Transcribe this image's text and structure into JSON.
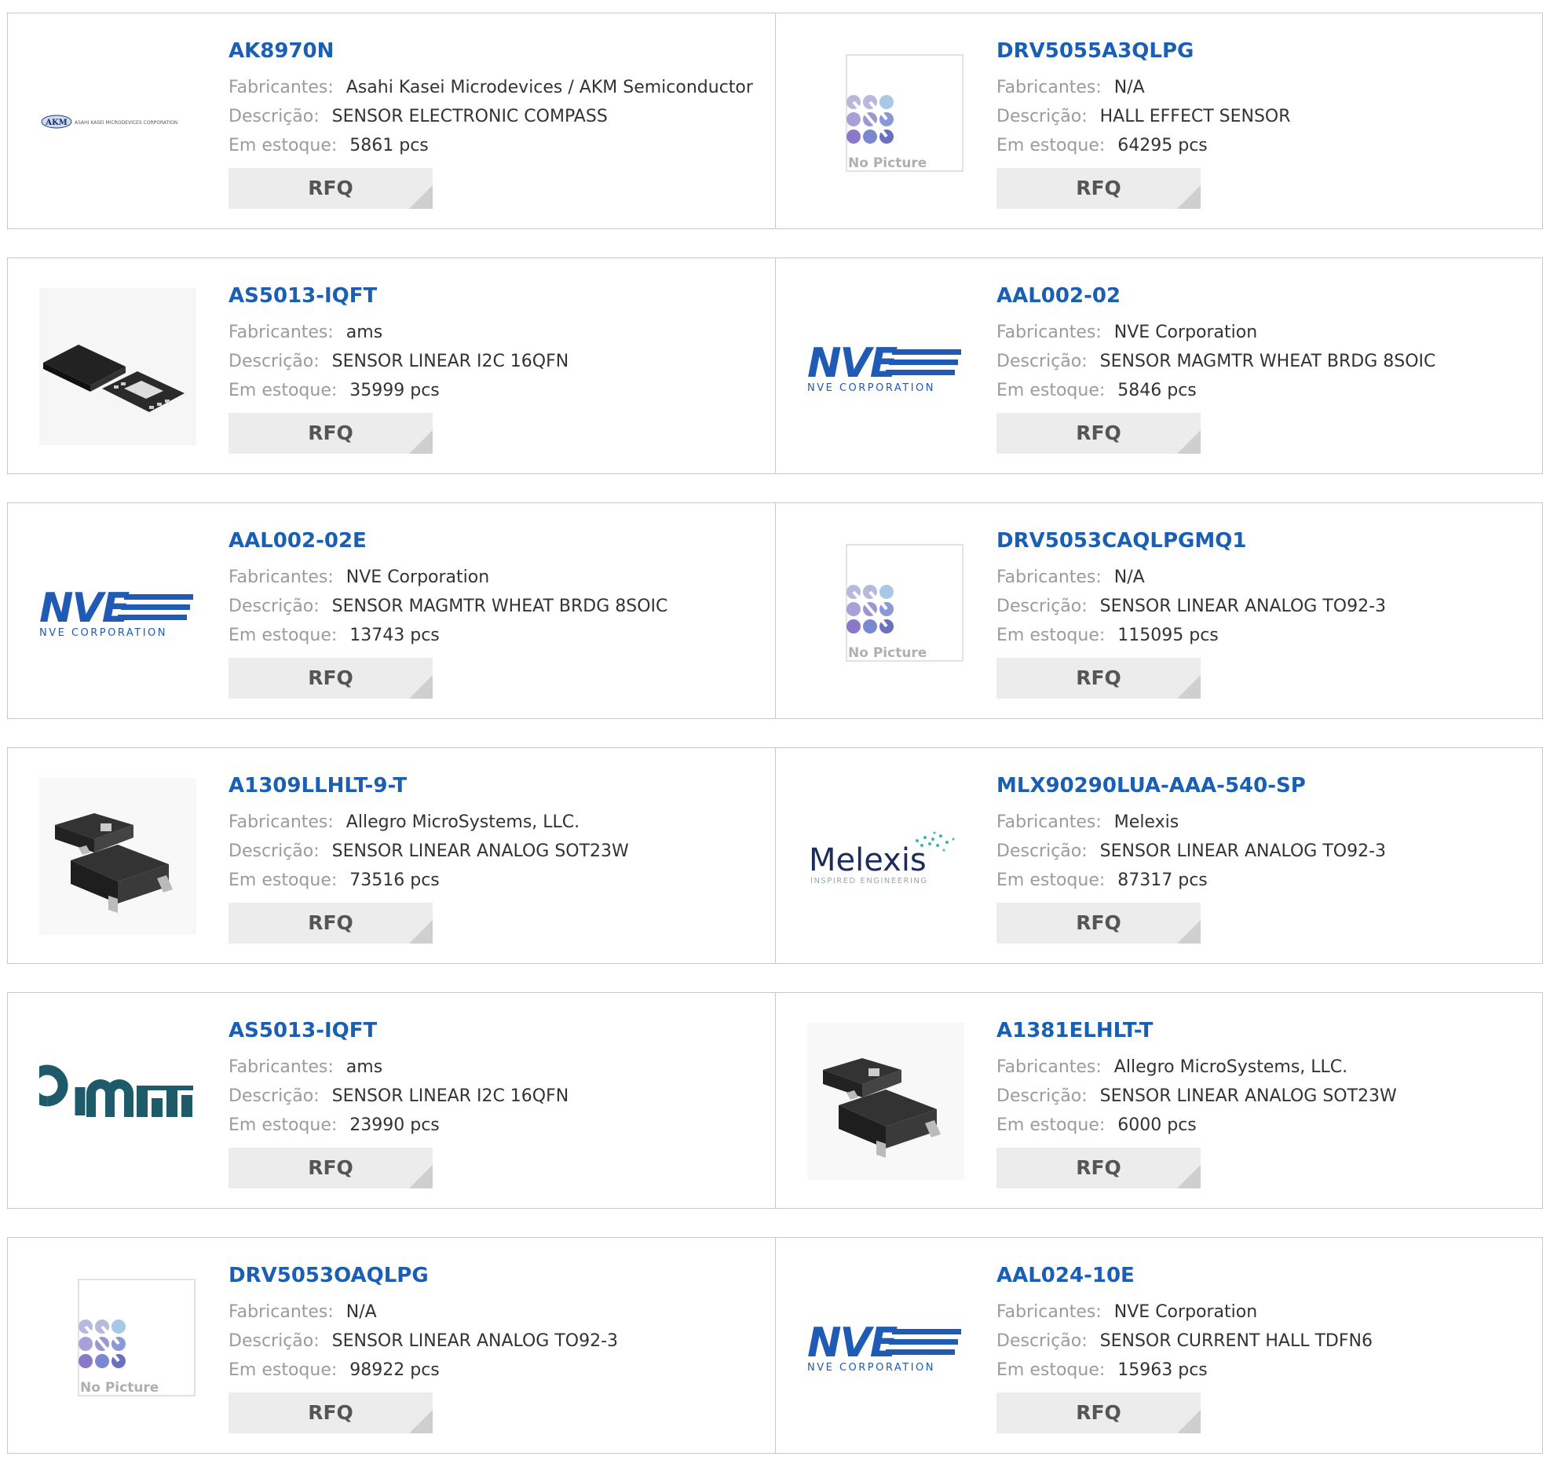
{
  "labels": {
    "manufacturer": "Fabricantes:",
    "description": "Descrição:",
    "stock": "Em estoque:",
    "rfq": "RFQ",
    "no_picture": "No Picture"
  },
  "products": [
    {
      "part": "AK8970N",
      "manufacturer": "Asahi Kasei Microdevices / AKM Semiconductor",
      "description": "SENSOR ELECTRONIC COMPASS",
      "stock": "5861 pcs",
      "image": "akm-logo",
      "logo_text": "AKM",
      "logo_subtext": "ASAHI KASEI MICRODEVICES CORPORATION"
    },
    {
      "part": "DRV5055A3QLPG",
      "manufacturer": "N/A",
      "description": "HALL EFFECT SENSOR",
      "stock": "64295 pcs",
      "image": "no-picture"
    },
    {
      "part": "AS5013-IQFT",
      "manufacturer": "ams",
      "description": "SENSOR LINEAR I2C 16QFN",
      "stock": "35999 pcs",
      "image": "qfn-chip"
    },
    {
      "part": "AAL002-02",
      "manufacturer": "NVE Corporation",
      "description": "SENSOR MAGMTR WHEAT BRDG 8SOIC",
      "stock": "5846 pcs",
      "image": "nve-logo",
      "logo_text": "NVE",
      "logo_subtext": "NVE CORPORATION"
    },
    {
      "part": "AAL002-02E",
      "manufacturer": "NVE Corporation",
      "description": "SENSOR MAGMTR WHEAT BRDG 8SOIC",
      "stock": "13743 pcs",
      "image": "nve-logo",
      "logo_text": "NVE",
      "logo_subtext": "NVE CORPORATION"
    },
    {
      "part": "DRV5053CAQLPGMQ1",
      "manufacturer": "N/A",
      "description": "SENSOR LINEAR ANALOG TO92-3",
      "stock": "115095 pcs",
      "image": "no-picture"
    },
    {
      "part": "A1309LLHLT-9-T",
      "manufacturer": "Allegro MicroSystems, LLC.",
      "description": "SENSOR LINEAR ANALOG SOT23W",
      "stock": "73516 pcs",
      "image": "sot-chip"
    },
    {
      "part": "MLX90290LUA-AAA-540-SP",
      "manufacturer": "Melexis",
      "description": "SENSOR LINEAR ANALOG TO92-3",
      "stock": "87317 pcs",
      "image": "melexis-logo",
      "logo_text": "Melexis",
      "logo_subtext": "INSPIRED ENGINEERING"
    },
    {
      "part": "AS5013-IQFT",
      "manufacturer": "ams",
      "description": "SENSOR LINEAR I2C 16QFN",
      "stock": "23990 pcs",
      "image": "ams-logo"
    },
    {
      "part": "A1381ELHLT-T",
      "manufacturer": "Allegro MicroSystems, LLC.",
      "description": "SENSOR LINEAR ANALOG SOT23W",
      "stock": "6000 pcs",
      "image": "sot-chip"
    },
    {
      "part": "DRV5053OAQLPG",
      "manufacturer": "N/A",
      "description": "SENSOR LINEAR ANALOG TO92-3",
      "stock": "98922 pcs",
      "image": "no-picture"
    },
    {
      "part": "AAL024-10E",
      "manufacturer": "NVE Corporation",
      "description": "SENSOR CURRENT HALL TDFN6",
      "stock": "15963 pcs",
      "image": "nve-logo",
      "logo_text": "NVE",
      "logo_subtext": "NVE CORPORATION"
    }
  ],
  "colors": {
    "link": "#1a5fb4",
    "label": "#9b9b9b",
    "rfq_bg": "#ececec",
    "border": "#c8c8c8"
  }
}
